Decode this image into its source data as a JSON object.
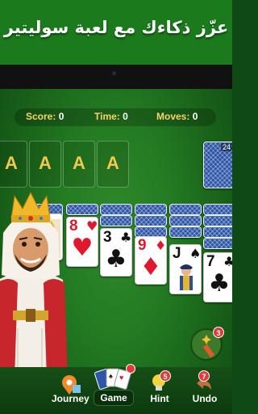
{
  "banner": {
    "title": "عزّز ذكاءك مع لعبة سوليتير"
  },
  "stats": {
    "score_label": "Score:",
    "score_value": "0",
    "time_label": "Time:",
    "time_value": "0",
    "moves_label": "Moves:",
    "moves_value": "0"
  },
  "foundations": [
    {
      "label": "A"
    },
    {
      "label": "A"
    },
    {
      "label": "A"
    },
    {
      "label": "A"
    }
  ],
  "stock": {
    "count": "24"
  },
  "tableau": [
    {
      "rank": "8",
      "suit": "♥",
      "color": "red"
    },
    {
      "rank": "3",
      "suit": "♣",
      "color": "black"
    },
    {
      "rank": "9",
      "suit": "♦",
      "color": "red"
    },
    {
      "rank": "J",
      "suit": "♠",
      "color": "black"
    },
    {
      "rank": "7",
      "suit": "♣",
      "color": "black"
    }
  ],
  "toolbar": {
    "journey_label": "Journey",
    "game_label": "Game",
    "hint_label": "Hint",
    "hint_badge": "5",
    "undo_label": "Undo",
    "undo_badge": "7",
    "wand_badge": "3"
  },
  "colors": {
    "table_green": "#237a22",
    "accent_gold": "#f6d46a",
    "card_back_blue": "#2d56a6"
  },
  "icons": [
    "king-character-icon",
    "magic-wand-icon",
    "map-icon",
    "playing-cards-icon",
    "lightbulb-icon",
    "undo-arrow-icon",
    "queen-character-icon"
  ]
}
